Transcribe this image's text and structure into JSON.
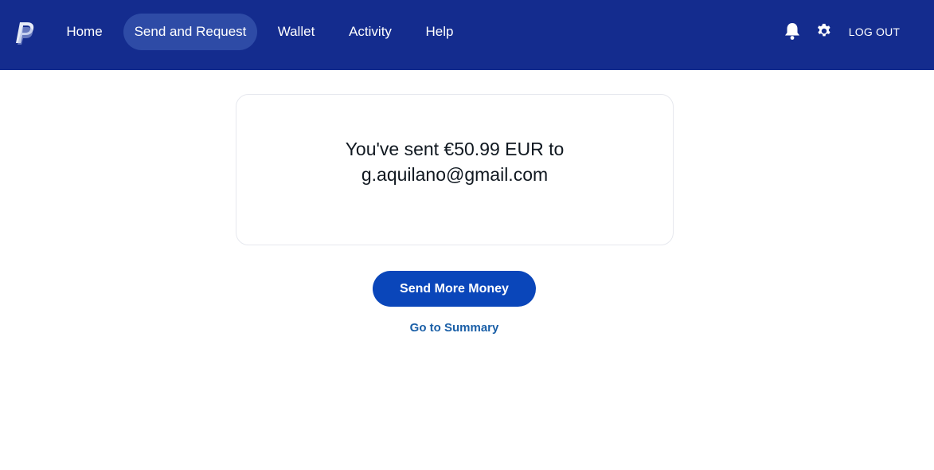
{
  "header": {
    "logo_icon": "paypal-logo-icon",
    "nav": [
      {
        "label": "Home",
        "active": false
      },
      {
        "label": "Send and Request",
        "active": true
      },
      {
        "label": "Wallet",
        "active": false
      },
      {
        "label": "Activity",
        "active": false
      },
      {
        "label": "Help",
        "active": false
      }
    ],
    "notifications_icon": "bell-icon",
    "settings_icon": "gear-icon",
    "logout_label": "LOG OUT"
  },
  "confirmation": {
    "line1": "You've sent €50.99 EUR to",
    "line2": "g.aquilano@gmail.com"
  },
  "actions": {
    "primary_label": "Send More Money",
    "link_label": "Go to Summary"
  },
  "colors": {
    "header_bg": "#142c8e",
    "nav_active_bg": "#2e4ba6",
    "primary_button": "#0a46ba",
    "link": "#1a5fa7",
    "text": "#101820"
  }
}
